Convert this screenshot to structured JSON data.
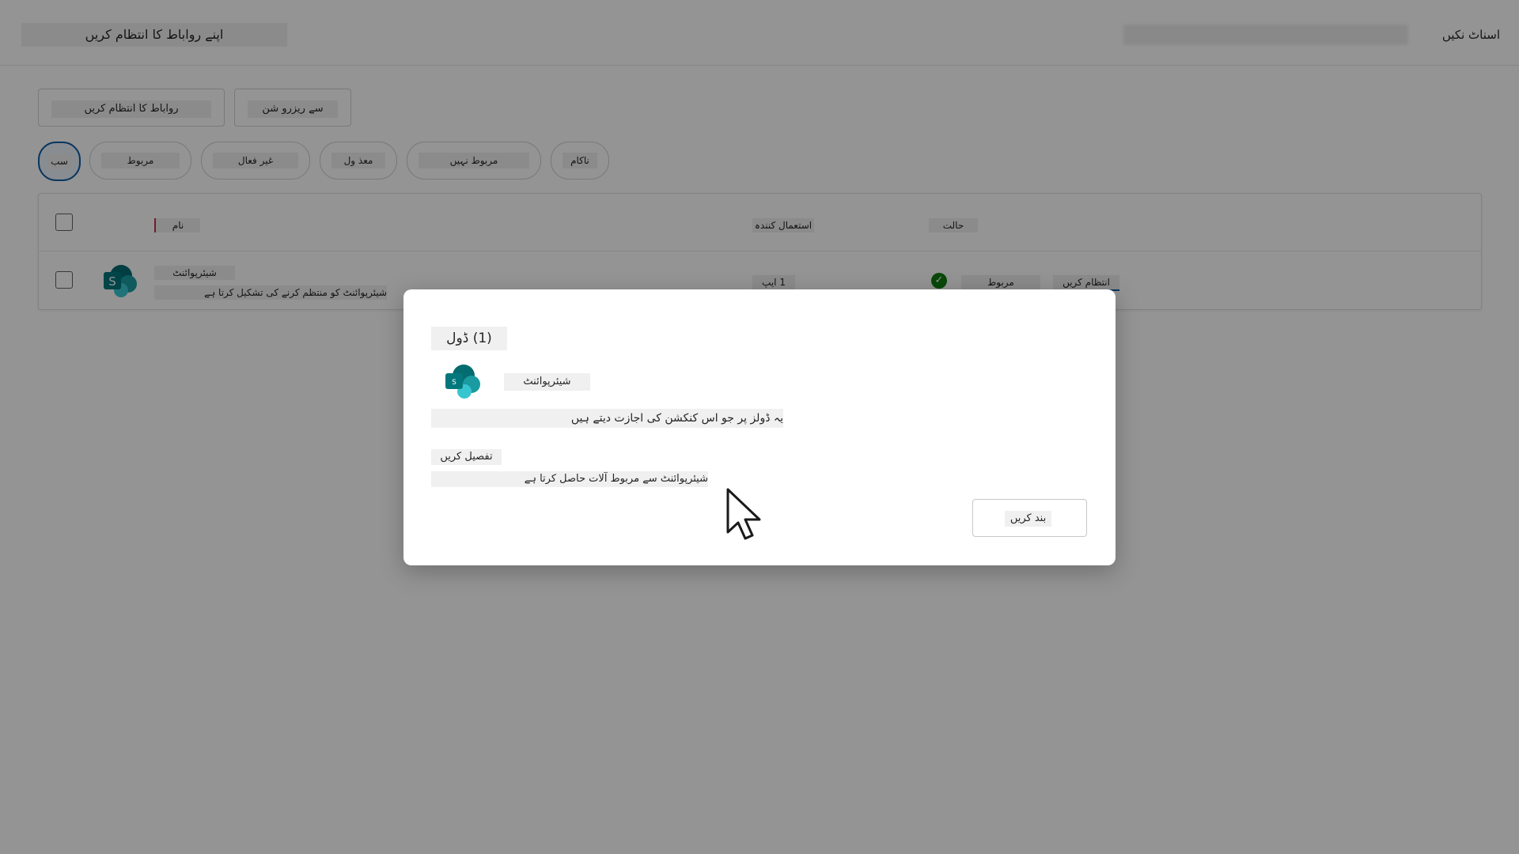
{
  "header": {
    "title": "اپنے رواباط کا انتظام کریں",
    "user_label": "اسناٹ نکیں",
    "search_blurred": ""
  },
  "actions": {
    "primary_label": "رواباط کا انتظام کریں",
    "secondary_label": "سے ریزرو شن"
  },
  "filters": [
    {
      "label": "سب",
      "active": true
    },
    {
      "label": "مربوط"
    },
    {
      "label": "غیر فعال"
    },
    {
      "label": "معذ ول"
    },
    {
      "label": "مربوط نہیں"
    },
    {
      "label": "ناکام"
    }
  ],
  "table": {
    "columns": {
      "name": "نام",
      "usage": "استعمال کنندہ",
      "status": "حالت"
    },
    "rows": [
      {
        "name": "شیئرپوائنٹ",
        "description": "شیئرپوائنٹ کو منتظم کرنے کی تشکیل کرتا ہے",
        "usage": "1 ایپ",
        "status": "مربوط",
        "action": "انتظام کریں"
      }
    ]
  },
  "dialog": {
    "title": "(1) ڈول",
    "app_name": "شیئرپوائنٹ",
    "description": "یہ ڈولز پر جو اس کنکشن کی اجازت دیتے ہیں",
    "permissions_title": "تفصیل کریں",
    "permissions_desc": "شیئرپوائنٹ سے مربوط آلات حاصل کرتا ہے",
    "close_label": "بند کریں"
  },
  "icons": {
    "app": "sharepoint-icon",
    "status": "check-circle-icon",
    "cursor": "mouse-pointer-icon"
  },
  "colors": {
    "sharepoint_primary": "#038387",
    "sharepoint_dark": "#036c70",
    "status_ok": "#107c10",
    "active_pill_border": "#115ea3"
  }
}
